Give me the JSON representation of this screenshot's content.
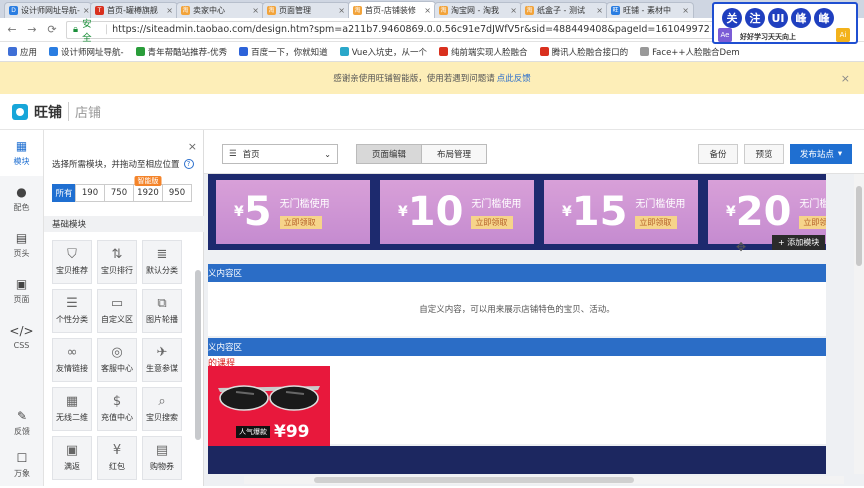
{
  "browser": {
    "tabs": [
      {
        "title": "设计师网址导航-",
        "color": "#2a7de1",
        "letter": "D"
      },
      {
        "title": "首页-罐樽旗舰",
        "color": "#d9301e",
        "letter": "T"
      },
      {
        "title": "卖家中心",
        "color": "#f2a33a",
        "letter": "淘"
      },
      {
        "title": "页面管理",
        "color": "#f2a33a",
        "letter": "淘"
      },
      {
        "title": "首页-店铺装修",
        "color": "#f2a33a",
        "letter": "淘"
      },
      {
        "title": "淘宝网 - 淘我",
        "color": "#f2a33a",
        "letter": "淘"
      },
      {
        "title": "纸盒子 - 测试",
        "color": "#f2a33a",
        "letter": "淘"
      },
      {
        "title": "旺铺 - 素材中",
        "color": "#2a7de1",
        "letter": "旺"
      }
    ],
    "active_tab": 4,
    "secure_label": "安全",
    "url": "https://siteadmin.taobao.com/design.htm?spm=a211b7.9460869.0.0.56c91e7dJWfV5r&sid=488449408&pageId=1610499721",
    "bookmarks": [
      {
        "label": "应用",
        "color": "#3f6fd6"
      },
      {
        "label": "设计师网址导航-",
        "color": "#2a7de1"
      },
      {
        "label": "青年帮酷站推荐-优秀",
        "color": "#2a9d3a"
      },
      {
        "label": "百度一下，你就知道",
        "color": "#2d63d9"
      },
      {
        "label": "Vue入坑史，从一个",
        "color": "#2aa7c9"
      },
      {
        "label": "纯前端实现人脸融合",
        "color": "#d9301e"
      },
      {
        "label": "腾讯人脸融合接口的",
        "color": "#d9301e"
      },
      {
        "label": "Face++人脸融合Dem",
        "color": "#999999"
      }
    ]
  },
  "notice": {
    "text": "感谢亲使用旺铺智能版，使用若遇到问题请",
    "link": "点此反馈",
    "close": "×"
  },
  "app": {
    "brand": "旺铺",
    "sub": "店铺"
  },
  "rail": [
    {
      "icon": "▦",
      "label": "模块",
      "name": "module"
    },
    {
      "icon": "●",
      "label": "配色",
      "name": "color"
    },
    {
      "icon": "▤",
      "label": "页头",
      "name": "header"
    },
    {
      "icon": "▣",
      "label": "页面",
      "name": "page"
    },
    {
      "icon": "</>",
      "label": "CSS",
      "name": "css"
    }
  ],
  "rail_bottom": [
    {
      "icon": "✎",
      "label": "反馈",
      "name": "feedback"
    },
    {
      "icon": "☐",
      "label": "万象",
      "name": "wanxiang"
    }
  ],
  "panel": {
    "title": "选择所需模块，并拖动至相应位置",
    "help": "?",
    "close": "×",
    "sizes": [
      {
        "label": "所有",
        "w": 24,
        "on": true
      },
      {
        "label": "190",
        "w": 30
      },
      {
        "label": "750",
        "w": 30
      },
      {
        "label": "1920",
        "w": 30,
        "tag": "智能版"
      },
      {
        "label": "950",
        "w": 30
      }
    ],
    "section": "基础模块",
    "modules": [
      {
        "icon": "⛉",
        "label": "宝贝推荐"
      },
      {
        "icon": "⇅",
        "label": "宝贝排行"
      },
      {
        "icon": "≣",
        "label": "默认分类"
      },
      {
        "icon": "☰",
        "label": "个性分类"
      },
      {
        "icon": "▭",
        "label": "自定义区"
      },
      {
        "icon": "⧉",
        "label": "图片轮播"
      },
      {
        "icon": "∞",
        "label": "友情链接"
      },
      {
        "icon": "◎",
        "label": "客服中心"
      },
      {
        "icon": "✈",
        "label": "生意参谋"
      },
      {
        "icon": "▦",
        "label": "无线二维"
      },
      {
        "icon": "$",
        "label": "充值中心"
      },
      {
        "icon": "⌕",
        "label": "宝贝搜索"
      },
      {
        "icon": "▣",
        "label": "满返"
      },
      {
        "icon": "¥",
        "label": "红包"
      },
      {
        "icon": "▤",
        "label": "购物券"
      }
    ]
  },
  "toolbar": {
    "page_select": "首页",
    "tabs": [
      {
        "label": "页面编辑",
        "on": true
      },
      {
        "label": "布局管理",
        "on": false
      }
    ],
    "backup": "备份",
    "preview": "预览",
    "publish": "发布站点"
  },
  "coupons": [
    {
      "value": "5",
      "text": "无门槛使用",
      "btn": "立即领取"
    },
    {
      "value": "10",
      "text": "无门槛使用",
      "btn": "立即领取"
    },
    {
      "value": "15",
      "text": "无门槛使用",
      "btn": "立即领取"
    },
    {
      "value": "20",
      "text": "无门槛使用",
      "btn": "立即领取"
    }
  ],
  "currency": "¥",
  "add_module": "+ 添加模块",
  "custom1": {
    "title": "义内容区",
    "body": "自定义内容，可以用来展示店铺特色的宝贝、活动。"
  },
  "custom2": {
    "title": "义内容区",
    "red_text": "的课程"
  },
  "product": {
    "badge": "人气爆款",
    "price": "¥99"
  },
  "watermark": {
    "chars": [
      "关",
      "注",
      "UI",
      "峰",
      "峰"
    ],
    "slogan": "好好学习天天向上",
    "left_badge": "Ae",
    "right_badge": "Ai"
  }
}
